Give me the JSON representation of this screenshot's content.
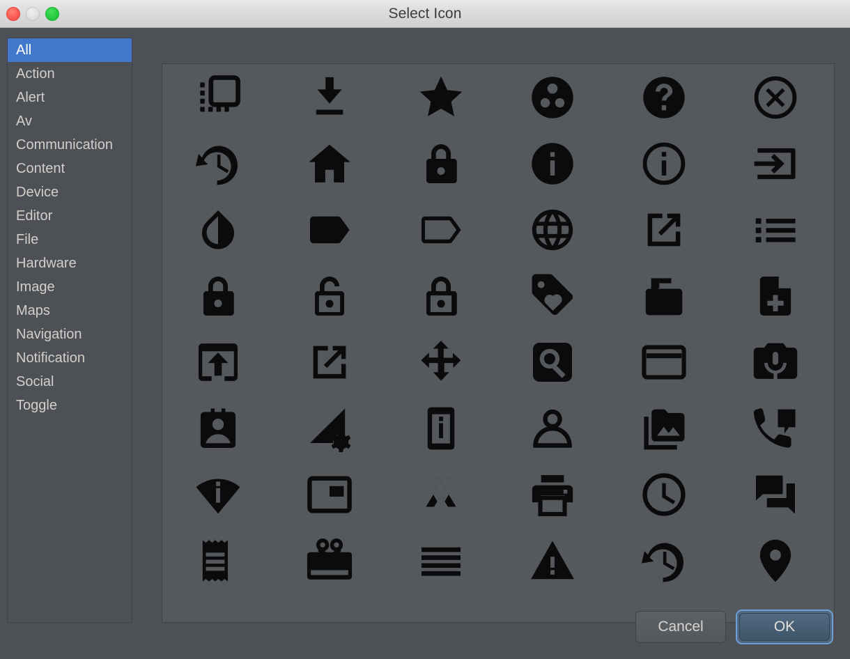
{
  "window": {
    "title": "Select Icon",
    "controls": [
      {
        "name": "close-button",
        "color": "#ff6159"
      },
      {
        "name": "minimize-button",
        "color": "#e2e2e2"
      },
      {
        "name": "zoom-button",
        "color": "#28cd41"
      }
    ]
  },
  "sidebar": {
    "selected": "All",
    "items": [
      {
        "label": "All",
        "selected": true
      },
      {
        "label": "Action",
        "selected": false
      },
      {
        "label": "Alert",
        "selected": false
      },
      {
        "label": "Av",
        "selected": false
      },
      {
        "label": "Communication",
        "selected": false
      },
      {
        "label": "Content",
        "selected": false
      },
      {
        "label": "Device",
        "selected": false
      },
      {
        "label": "Editor",
        "selected": false
      },
      {
        "label": "File",
        "selected": false
      },
      {
        "label": "Hardware",
        "selected": false
      },
      {
        "label": "Image",
        "selected": false
      },
      {
        "label": "Maps",
        "selected": false
      },
      {
        "label": "Navigation",
        "selected": false
      },
      {
        "label": "Notification",
        "selected": false
      },
      {
        "label": "Social",
        "selected": false
      },
      {
        "label": "Toggle",
        "selected": false
      }
    ]
  },
  "grid": {
    "columns": 6,
    "icons": [
      "selection-square-icon",
      "download-to-line-icon",
      "star-icon",
      "bubble-chart-circle-icon",
      "help-filled-icon",
      "cancel-circle-outline-icon",
      "history-restore-icon",
      "home-icon",
      "lock-closed-filled-icon",
      "info-filled-icon",
      "info-outline-icon",
      "login-arrow-icon",
      "opacity-drop-icon",
      "label-filled-icon",
      "label-outline-icon",
      "globe-language-icon",
      "open-in-new-icon",
      "list-bullets-icon",
      "lock-filled-icon",
      "lock-open-icon",
      "lock-outline-icon",
      "loyalty-tag-heart-icon",
      "markunread-mailbox-icon",
      "note-add-icon",
      "open-in-browser-icon",
      "launch-icon",
      "pan-move-arrows-icon",
      "search-rounded-square-icon",
      "payment-card-icon",
      "perm-camera-mic-icon",
      "contact-badge-icon",
      "network-settings-icon",
      "phone-info-icon",
      "person-outline-icon",
      "photo-library-icon",
      "phone-message-icon",
      "wifi-info-icon",
      "picture-in-picture-icon",
      "polymer-icon",
      "print-icon",
      "clock-schedule-icon",
      "question-answer-icon",
      "receipt-icon",
      "card-giftcard-icon",
      "reorder-lines-icon",
      "report-warning-icon",
      "restore-history-icon",
      "room-pin-icon",
      "partial-row-1-icon",
      "partial-row-2-icon",
      "partial-row-3-icon",
      "partial-row-4-icon",
      "partial-row-5-icon",
      "partial-row-6-icon"
    ]
  },
  "footer": {
    "cancel_label": "Cancel",
    "ok_label": "OK",
    "focus_color": "#6f9fd8"
  }
}
